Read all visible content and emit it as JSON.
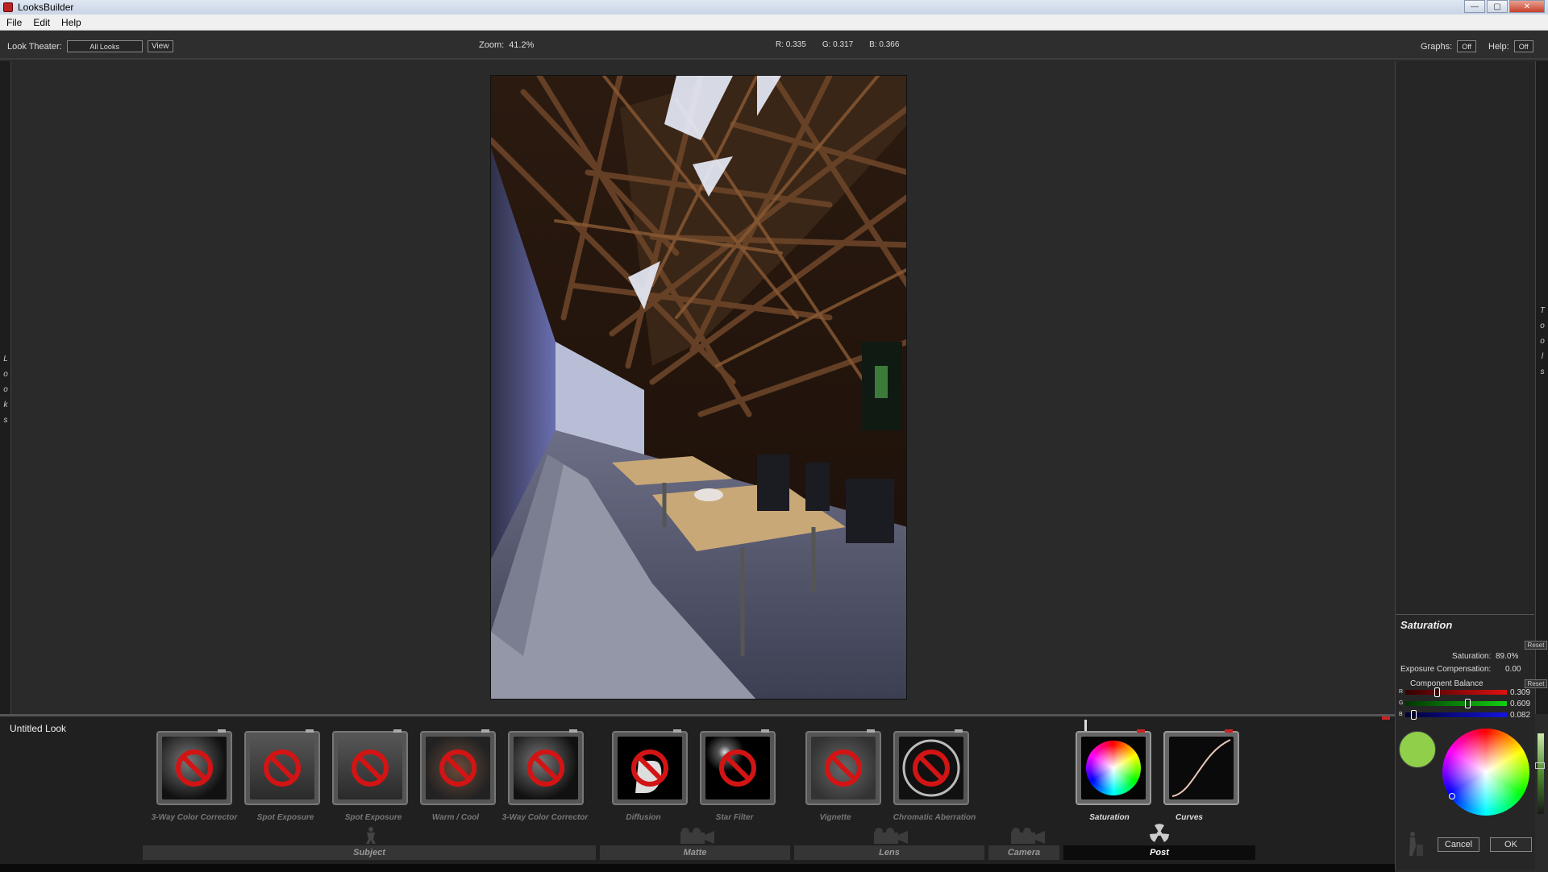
{
  "app": {
    "title": "LooksBuilder"
  },
  "window_buttons": {
    "minimize": "—",
    "maximize": "▢",
    "close": "✕"
  },
  "menu": [
    "File",
    "Edit",
    "Help"
  ],
  "toolbar": {
    "look_theater_label": "Look Theater:",
    "look_theater_value": "All Looks",
    "view_button": "View",
    "zoom_label": "Zoom:",
    "zoom_value": "41.2%",
    "r_readout": "R: 0.335",
    "g_readout": "G: 0.317",
    "b_readout": "B: 0.366",
    "graphs_label": "Graphs:",
    "graphs_value": "Off",
    "help_label": "Help:",
    "help_value": "Off"
  },
  "left_sidebar": {
    "label": [
      "L",
      "o",
      "o",
      "k",
      "s"
    ]
  },
  "right_sidebar": {
    "label": [
      "T",
      "o",
      "o",
      "l",
      "s"
    ]
  },
  "look": {
    "title": "Untitled Look"
  },
  "tools": [
    {
      "label": "3-Way Color Corrector",
      "enabled": false
    },
    {
      "label": "Spot Exposure",
      "enabled": false
    },
    {
      "label": "Spot Exposure",
      "enabled": false
    },
    {
      "label": "Warm / Cool",
      "enabled": false
    },
    {
      "label": "3-Way Color Corrector",
      "enabled": false
    },
    {
      "label": "Diffusion",
      "enabled": false
    },
    {
      "label": "Star Filter",
      "enabled": false
    },
    {
      "label": "Vignette",
      "enabled": false
    },
    {
      "label": "Chromatic Aberration",
      "enabled": false
    },
    {
      "label": "Saturation",
      "enabled": true
    },
    {
      "label": "Curves",
      "enabled": true
    }
  ],
  "categories": [
    {
      "label": "Subject",
      "active": false
    },
    {
      "label": "Matte",
      "active": false
    },
    {
      "label": "Lens",
      "active": false
    },
    {
      "label": "Camera",
      "active": false
    },
    {
      "label": "Post",
      "active": true
    }
  ],
  "panel": {
    "title": "Saturation",
    "reset": "Reset",
    "saturation_label": "Saturation:",
    "saturation_value": "89.0%",
    "exposure_label": "Exposure Compensation:",
    "exposure_value": "0.00",
    "balance_label": "Component Balance",
    "balance_reset": "Reset",
    "r_label": "R",
    "g_label": "G",
    "b_label": "B",
    "r_value": "0.309",
    "g_value": "0.609",
    "b_value": "0.082",
    "r_level": 0.309,
    "g_level": 0.609,
    "b_level": 0.082,
    "swatch_color": "#8fcf4a",
    "cancel": "Cancel",
    "ok": "OK"
  },
  "colors": {
    "disabled_red": "#d21414",
    "post_active": "#0c0c0c"
  }
}
